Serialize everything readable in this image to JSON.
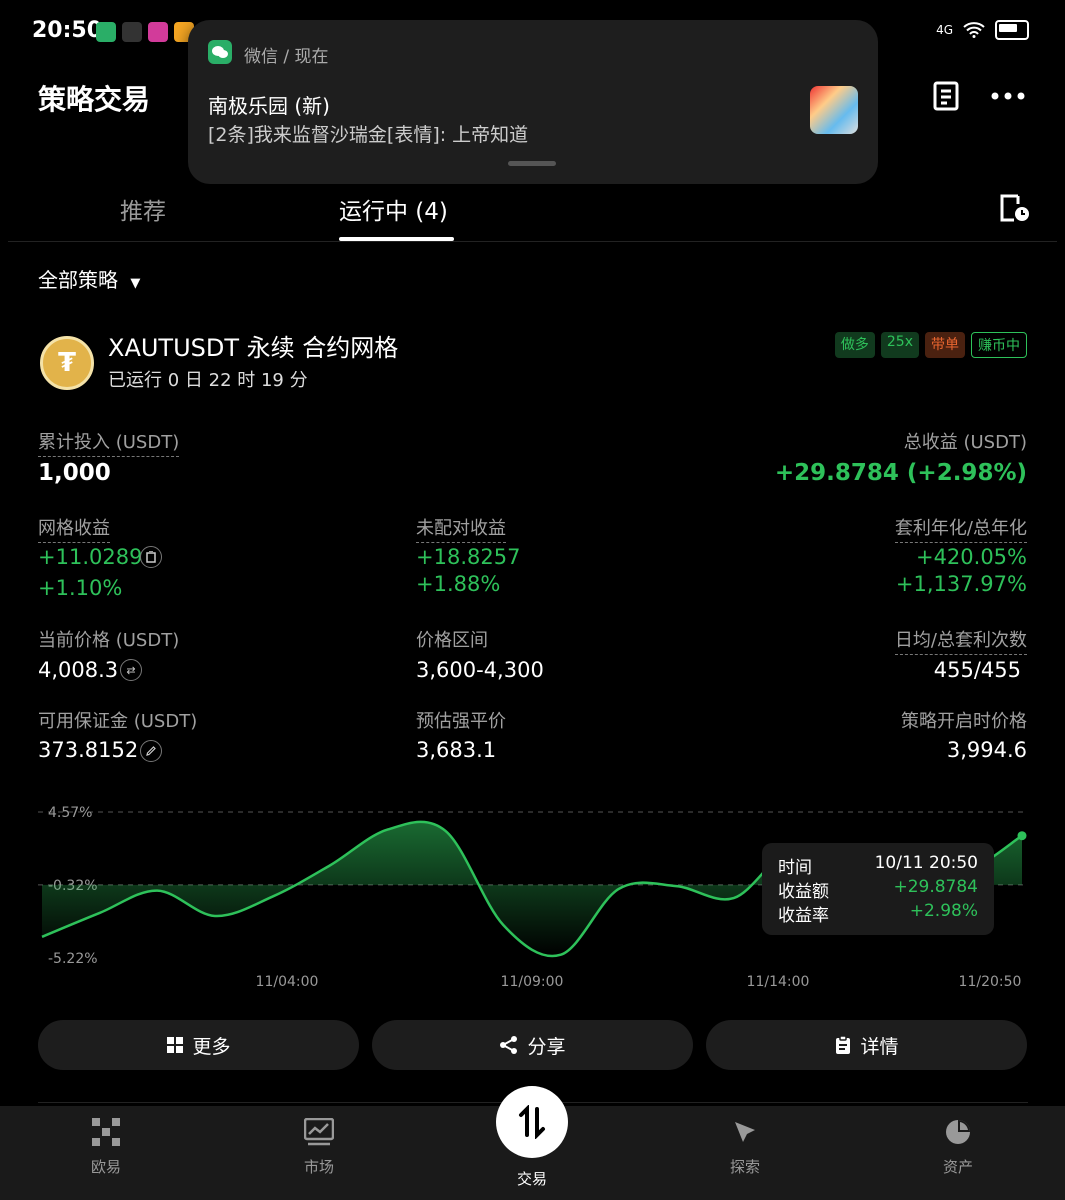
{
  "status": {
    "time": "20:50",
    "network": "4G"
  },
  "header": {
    "title": "策略交易"
  },
  "notification": {
    "app": "微信 / 现在",
    "title": "南极乐园 (新)",
    "message": "[2条]我来监督沙瑞金[表情]: 上帝知道"
  },
  "tabs": [
    {
      "label": "推荐"
    },
    {
      "label": "运行中 (4)"
    }
  ],
  "filter": {
    "label": "全部策略"
  },
  "strategy": {
    "logo": "₮",
    "title": "XAUTUSDT 永续 合约网格",
    "runtime": "已运行 0 日 22 时 19 分",
    "badges": [
      "做多",
      "25x",
      "带单",
      "赚币中"
    ],
    "colors": {
      "green": "#2ec15a",
      "orange": "#e8652f"
    },
    "invested_label": "累计投入 (USDT)",
    "invested": "1,000",
    "total_profit_label": "总收益 (USDT)",
    "total_profit": "+29.8784 (+2.98%)",
    "grid_profit_label": "网格收益",
    "grid_profit": "+11.0289",
    "grid_profit_pct": "+1.10%",
    "unmatched_label": "未配对收益",
    "unmatched": "+18.8257",
    "unmatched_pct": "+1.88%",
    "apr_label": "套利年化/总年化",
    "apr": "+420.05%",
    "total_apr": "+1,137.97%",
    "price_label": "当前价格 (USDT)",
    "price": "4,008.3",
    "range_label": "价格区间",
    "range": "3,600-4,300",
    "arb_count_label": "日均/总套利次数",
    "arb_count": "455/455",
    "margin_label": "可用保证金 (USDT)",
    "margin": "373.8152",
    "liq_label": "预估强平价",
    "liq": "3,683.1",
    "start_price_label": "策略开启时价格",
    "start_price": "3,994.6"
  },
  "chart_data": {
    "type": "area",
    "y_ticks": [
      "4.57%",
      "-0.32%",
      "-5.22%"
    ],
    "x_ticks": [
      "11/04:00",
      "11/09:00",
      "11/14:00",
      "11/20:50"
    ],
    "ylim": [
      -5.22,
      4.57
    ],
    "series": [
      {
        "values": [
          -3.8,
          -2.2,
          -0.7,
          -2.4,
          -1.1,
          1.0,
          3.4,
          3.3,
          -3.0,
          -5.0,
          -0.6,
          -0.4,
          -1.2,
          2.0,
          0.3,
          0.4,
          0.5,
          2.98
        ]
      }
    ],
    "tooltip": {
      "time_label": "时间",
      "time": "10/11 20:50",
      "amount_label": "收益额",
      "amount": "+29.8784",
      "rate_label": "收益率",
      "rate": "+2.98%"
    }
  },
  "buttons": {
    "more": "更多",
    "share": "分享",
    "details": "详情"
  },
  "nav": [
    {
      "label": "欧易"
    },
    {
      "label": "市场"
    },
    {
      "label": "交易"
    },
    {
      "label": "探索"
    },
    {
      "label": "资产"
    }
  ]
}
